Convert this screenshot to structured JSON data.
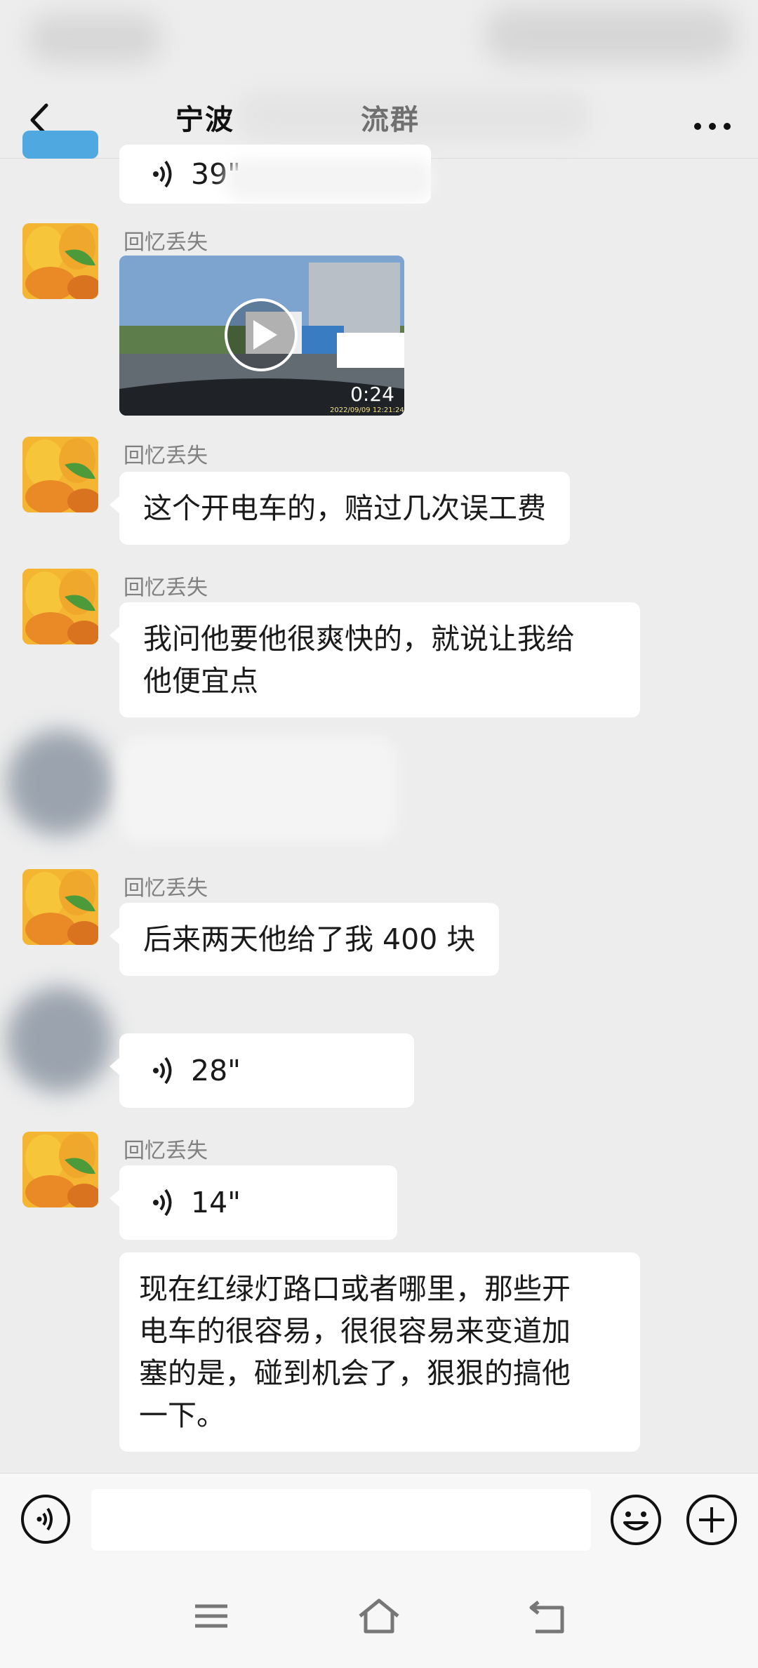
{
  "header": {
    "title": "宁波",
    "title_tail": "流群",
    "back_icon": "chevron-left-icon",
    "more_icon": "more-dots-icon"
  },
  "messages": [
    {
      "type": "voice",
      "duration": "39\"",
      "partial": true
    },
    {
      "type": "video",
      "sender": "回忆丢失",
      "duration": "0:24",
      "timestamp": "2022/09/09 12:21:24"
    },
    {
      "type": "text",
      "sender": "回忆丢失",
      "text": "这个开电车的，赔过几次误工费"
    },
    {
      "type": "text",
      "sender": "回忆丢失",
      "lines": [
        "我问他要他很爽快的，就说让我给",
        "他便宜点"
      ]
    },
    {
      "type": "redacted"
    },
    {
      "type": "text",
      "sender": "回忆丢失",
      "text": "后来两天他给了我 400 块"
    },
    {
      "type": "voice",
      "duration": "28\"",
      "sender_redacted": true
    },
    {
      "type": "voice",
      "sender": "回忆丢失",
      "duration": "14\""
    },
    {
      "type": "text",
      "lines": [
        "现在红绿灯路口或者哪里，那些开",
        "电车的很容易，很很容易来变道加",
        "塞的是，碰到机会了，狠狠的搞他",
        "一下。"
      ]
    }
  ],
  "input_bar": {
    "placeholder": "",
    "voice_icon": "voice-toggle-icon",
    "emoji_icon": "emoji-icon",
    "plus_icon": "plus-icon"
  },
  "nav_bar": {
    "icons": [
      "menu-icon",
      "home-icon",
      "back-icon"
    ]
  },
  "colors": {
    "background": "#ededed",
    "bubble": "#ffffff",
    "sender": "#808080"
  }
}
